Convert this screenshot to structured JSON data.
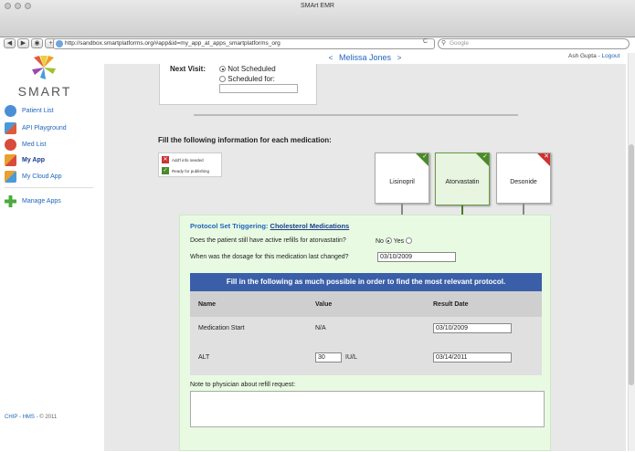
{
  "window": {
    "title": "SMArt EMR"
  },
  "browser": {
    "back": "◀",
    "forward": "▶",
    "add": "+",
    "url": "http://sandbox.smartplatforms.org/#app&id=my_app_at_apps_smartplatforms_org",
    "reload": "C",
    "search_placeholder": "Google"
  },
  "sidebar": {
    "logo_text": "SMART",
    "items": [
      {
        "label": "Patient List",
        "icon": "magnifier-icon",
        "color": "#4a8ed8"
      },
      {
        "label": "API Playground",
        "icon": "blocks-icon",
        "color": "#4a9ad8"
      },
      {
        "label": "Med List",
        "icon": "pill-icon",
        "color": "#d94a3a"
      },
      {
        "label": "My App",
        "icon": "app-icon",
        "color": "#e8a030"
      },
      {
        "label": "My Cloud App",
        "icon": "cloud-app-icon",
        "color": "#e8a030"
      },
      {
        "label": "Manage Apps",
        "icon": "plus-icon",
        "color": "#4aaa3a"
      }
    ],
    "footer": {
      "chip": "CHIP",
      "sep": " - ",
      "hms": "HMS",
      "copy": " - © 2011"
    }
  },
  "header": {
    "prev": "<",
    "patient": "Melissa Jones",
    "next": ">",
    "user": "Ash Gupta",
    "sep": " - ",
    "logout": "Logout"
  },
  "next_visit": {
    "label": "Next Visit:",
    "option1": "Not Scheduled",
    "option2": "Scheduled for:",
    "selected": "Not Scheduled"
  },
  "fill_heading": "Fill the following information for each medication:",
  "legend": {
    "needed": "Add'l info needed",
    "ready": "Ready for publishing"
  },
  "meds": [
    {
      "name": "Lisinopril",
      "status": "ready"
    },
    {
      "name": "Atorvastatin",
      "status": "ready",
      "selected": true
    },
    {
      "name": "Desonide",
      "status": "needed"
    }
  ],
  "protocol": {
    "title_prefix": "Protocol Set Triggering:",
    "title_link": "Cholesterol Medications",
    "q1": "Does the patient still have active refills for atorvastatin?",
    "q1_no": "No",
    "q1_yes": "Yes",
    "q1_selected": "No",
    "q2": "When was the dosage for this medication last changed?",
    "q2_value": "03/10/2009",
    "table_header": "Fill in the following as much possible in order to find the most relevant protocol.",
    "columns": [
      "Name",
      "Value",
      "Result Date"
    ],
    "rows": [
      {
        "name": "Medication Start",
        "value": "N/A",
        "date": "03/10/2009"
      },
      {
        "name": "ALT",
        "value": "30",
        "unit": "IU/L",
        "date": "03/14/2011"
      }
    ],
    "note_label": "Note to physician about refill request:"
  }
}
